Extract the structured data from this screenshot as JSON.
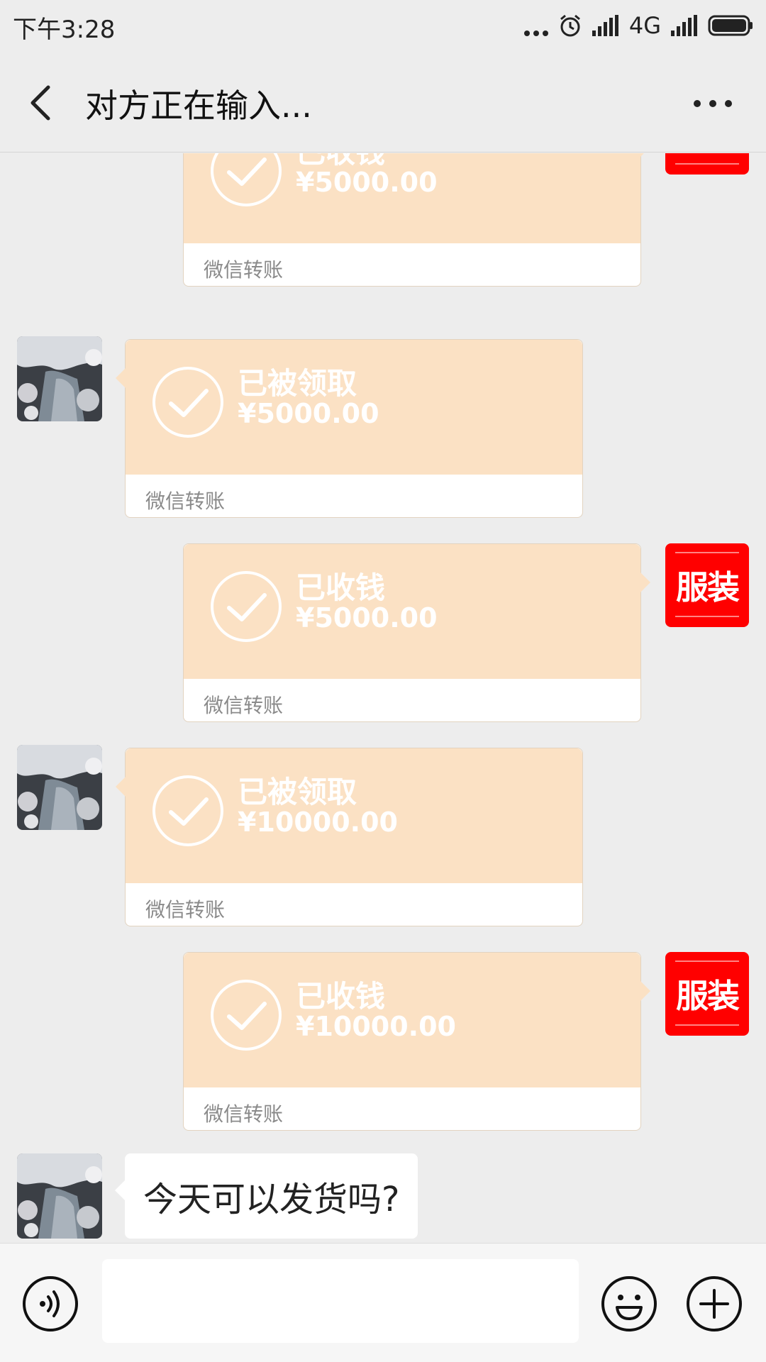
{
  "status_bar": {
    "time": "下午3:28",
    "network": "4G"
  },
  "header": {
    "title": "对方正在输入..."
  },
  "messages": [
    {
      "type": "transfer",
      "side": "mine",
      "status": "已收钱",
      "amount": "¥5000.00",
      "footer": "微信转账"
    },
    {
      "type": "transfer",
      "side": "other",
      "status": "已被领取",
      "amount": "¥5000.00",
      "footer": "微信转账"
    },
    {
      "type": "transfer",
      "side": "mine",
      "status": "已收钱",
      "amount": "¥5000.00",
      "footer": "微信转账"
    },
    {
      "type": "transfer",
      "side": "other",
      "status": "已被领取",
      "amount": "¥10000.00",
      "footer": "微信转账"
    },
    {
      "type": "transfer",
      "side": "mine",
      "status": "已收钱",
      "amount": "¥10000.00",
      "footer": "微信转账"
    },
    {
      "type": "text",
      "side": "other",
      "text": "今天可以发货吗?"
    }
  ],
  "my_avatar": {
    "logo_text": "服装",
    "color": "#ff0000"
  },
  "input_bar": {
    "value": "",
    "placeholder": ""
  },
  "icons": {
    "back": "chevron-left-icon",
    "more": "more-icon",
    "voice": "voice-icon",
    "emoji": "emoji-icon",
    "plus": "plus-icon",
    "check": "check-circle-icon"
  },
  "colors": {
    "transfer_bg": "#fbe1c4",
    "page_bg": "#ededed"
  }
}
